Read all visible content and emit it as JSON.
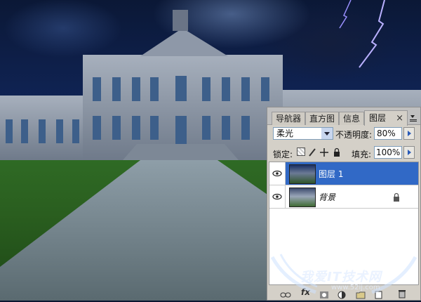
{
  "panel": {
    "tabs": [
      {
        "label": "导航器"
      },
      {
        "label": "直方图"
      },
      {
        "label": "信息"
      },
      {
        "label": "图层"
      }
    ],
    "close_glyph": "×",
    "blend_mode": "柔光",
    "opacity_label": "不透明度:",
    "opacity_value": "80%",
    "lock_label": "锁定:",
    "fill_label": "填充:",
    "fill_value": "100%",
    "layers": [
      {
        "name": "图层 1",
        "selected": true
      },
      {
        "name": "背景",
        "selected": false
      }
    ]
  },
  "watermark": {
    "title": "我爱IT技术网",
    "url": "www.52ij.com"
  }
}
